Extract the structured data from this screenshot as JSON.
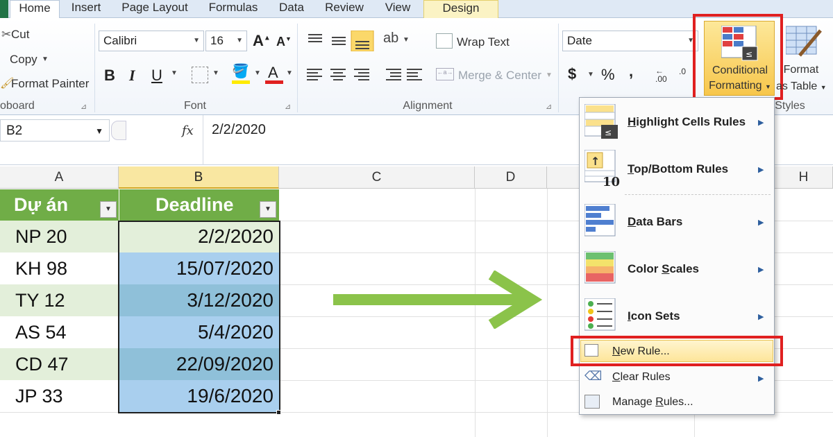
{
  "tabs": [
    "Home",
    "Insert",
    "Page Layout",
    "Formulas",
    "Data",
    "Review",
    "View",
    "Design"
  ],
  "clipboard": {
    "cut": "Cut",
    "copy": "Copy",
    "format_painter": "Format Painter",
    "group": "oboard"
  },
  "font": {
    "name": "Calibri",
    "size": "16",
    "group": "Font",
    "bold": "B",
    "italic": "I",
    "underline": "U",
    "grow": "A",
    "shrink": "A",
    "color": "A"
  },
  "alignment": {
    "wrap": "Wrap Text",
    "merge": "Merge & Center",
    "group": "Alignment"
  },
  "number": {
    "format": "Date",
    "currency": "$",
    "percent": "%",
    "comma": ",",
    "inc": ".0\n.00",
    "dec": ".00"
  },
  "styles": {
    "cf_line1": "Conditional",
    "cf_line2": "Formatting",
    "ft_line1": "Format",
    "ft_line2": "as Table",
    "group": "Styles"
  },
  "formula_bar": {
    "name_box": "B2",
    "fx": "fx",
    "value": "2/2/2020"
  },
  "columns": [
    "A",
    "B",
    "C",
    "D",
    "H"
  ],
  "table": {
    "headers": [
      "Dự án",
      "Deadline"
    ],
    "rows": [
      {
        "a": "NP 20",
        "b": "2/2/2020"
      },
      {
        "a": "KH 98",
        "b": "15/07/2020"
      },
      {
        "a": "TY 12",
        "b": "3/12/2020"
      },
      {
        "a": "AS 54",
        "b": "5/4/2020"
      },
      {
        "a": "CD 47",
        "b": "22/09/2020"
      },
      {
        "a": "JP 33",
        "b": "19/6/2020"
      }
    ]
  },
  "menu": {
    "highlight": {
      "u": "H",
      "rest": "ighlight Cells Rules"
    },
    "topbottom": {
      "u": "T",
      "rest": "op/Bottom Rules"
    },
    "databars": {
      "u": "D",
      "rest": "ata Bars"
    },
    "colorscales": {
      "pre": "Color ",
      "u": "S",
      "rest": "cales"
    },
    "iconsets": {
      "u": "I",
      "rest": "con Sets"
    },
    "newrule": {
      "u": "N",
      "rest": "ew Rule..."
    },
    "clearrules": {
      "u": "C",
      "rest": "lear Rules"
    },
    "managerules": {
      "pre": "Manage ",
      "u": "R",
      "rest": "ules..."
    }
  },
  "colors": {
    "accent_green": "#70ad47",
    "selection_blue": "#a9cfee",
    "cell_green_light": "#e3efda",
    "highlight_red": "#e02020",
    "arrow_green": "#8bc34a"
  }
}
